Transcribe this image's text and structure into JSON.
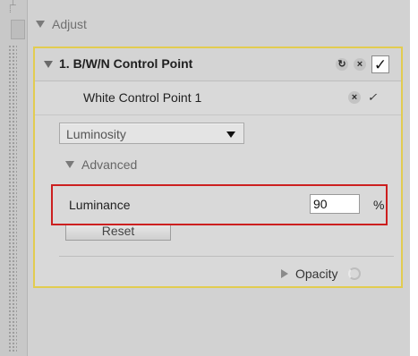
{
  "colors": {
    "panel_border": "#e2cc50",
    "highlight_border": "#cc1f1f"
  },
  "adjust": {
    "title": "Adjust",
    "icon": "triangle-down-icon"
  },
  "control_point": {
    "title": "1. B/W/N Control Point",
    "icons": [
      "reset-icon",
      "close-icon",
      "checkbox-checked-icon"
    ]
  },
  "white_control_point": {
    "label": "White Control Point 1",
    "icons": [
      "close-icon",
      "check-icon"
    ]
  },
  "mode_dropdown": {
    "value": "Luminosity"
  },
  "advanced": {
    "label": "Advanced"
  },
  "luminance": {
    "label": "Luminance",
    "value": "90",
    "unit": "%"
  },
  "reset": {
    "label": "Reset"
  },
  "opacity": {
    "label": "Opacity"
  }
}
